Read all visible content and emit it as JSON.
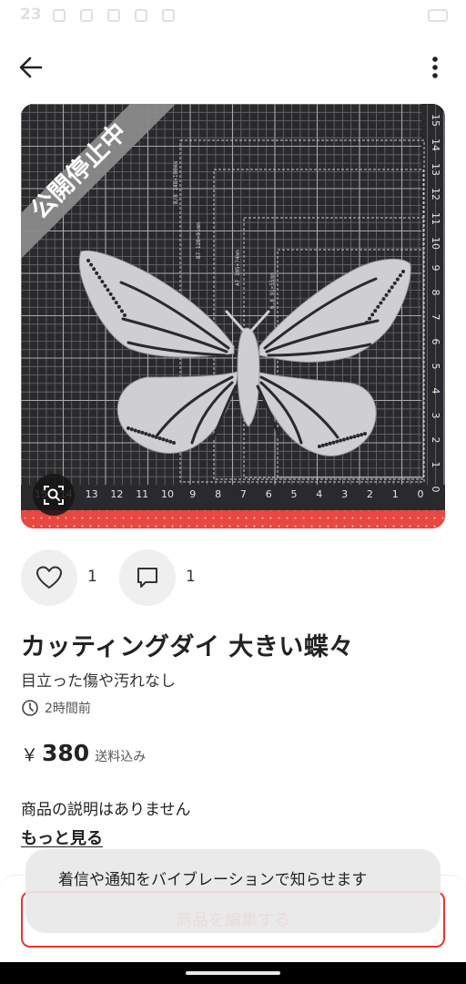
{
  "status_bar": {
    "time": "23"
  },
  "header": {
    "back_icon": "arrow-left-icon",
    "more_icon": "more-vertical-icon"
  },
  "image": {
    "banner_text": "公開停止中",
    "banner_color": "#8a8a8a",
    "mat_labels": [
      "B6 128×182mm",
      "B7 128×91mm",
      "A7 105×74mm",
      "6.8 91×55mm",
      "B/8 148×100mm"
    ],
    "ruler_bottom": [
      "15",
      "14",
      "13",
      "12",
      "11",
      "10",
      "9",
      "8",
      "7",
      "6",
      "5",
      "4",
      "3",
      "2",
      "1",
      "0"
    ],
    "ruler_right": [
      "15",
      "14",
      "13",
      "12",
      "11",
      "10",
      "9",
      "8",
      "7",
      "6",
      "5",
      "4",
      "3",
      "2",
      "1",
      "0"
    ],
    "zoom_icon": "zoom-scan-icon"
  },
  "actions": {
    "like_count": "1",
    "comment_count": "1"
  },
  "product": {
    "title": "カッティングダイ 大きい蝶々",
    "condition": "目立った傷や汚れなし",
    "posted": "2時間前",
    "price_symbol": "￥",
    "price": "380",
    "shipping_note": "送料込み",
    "description": "商品の説明はありません",
    "more_link": "もっと見る"
  },
  "bottom": {
    "edit_button": "商品を編集する"
  },
  "toast": {
    "message": "着信や通知をバイブレーションで知らせます"
  },
  "colors": {
    "accent": "#ea352d",
    "mat": "#2a2a2c",
    "background_red": "#e8483f"
  }
}
